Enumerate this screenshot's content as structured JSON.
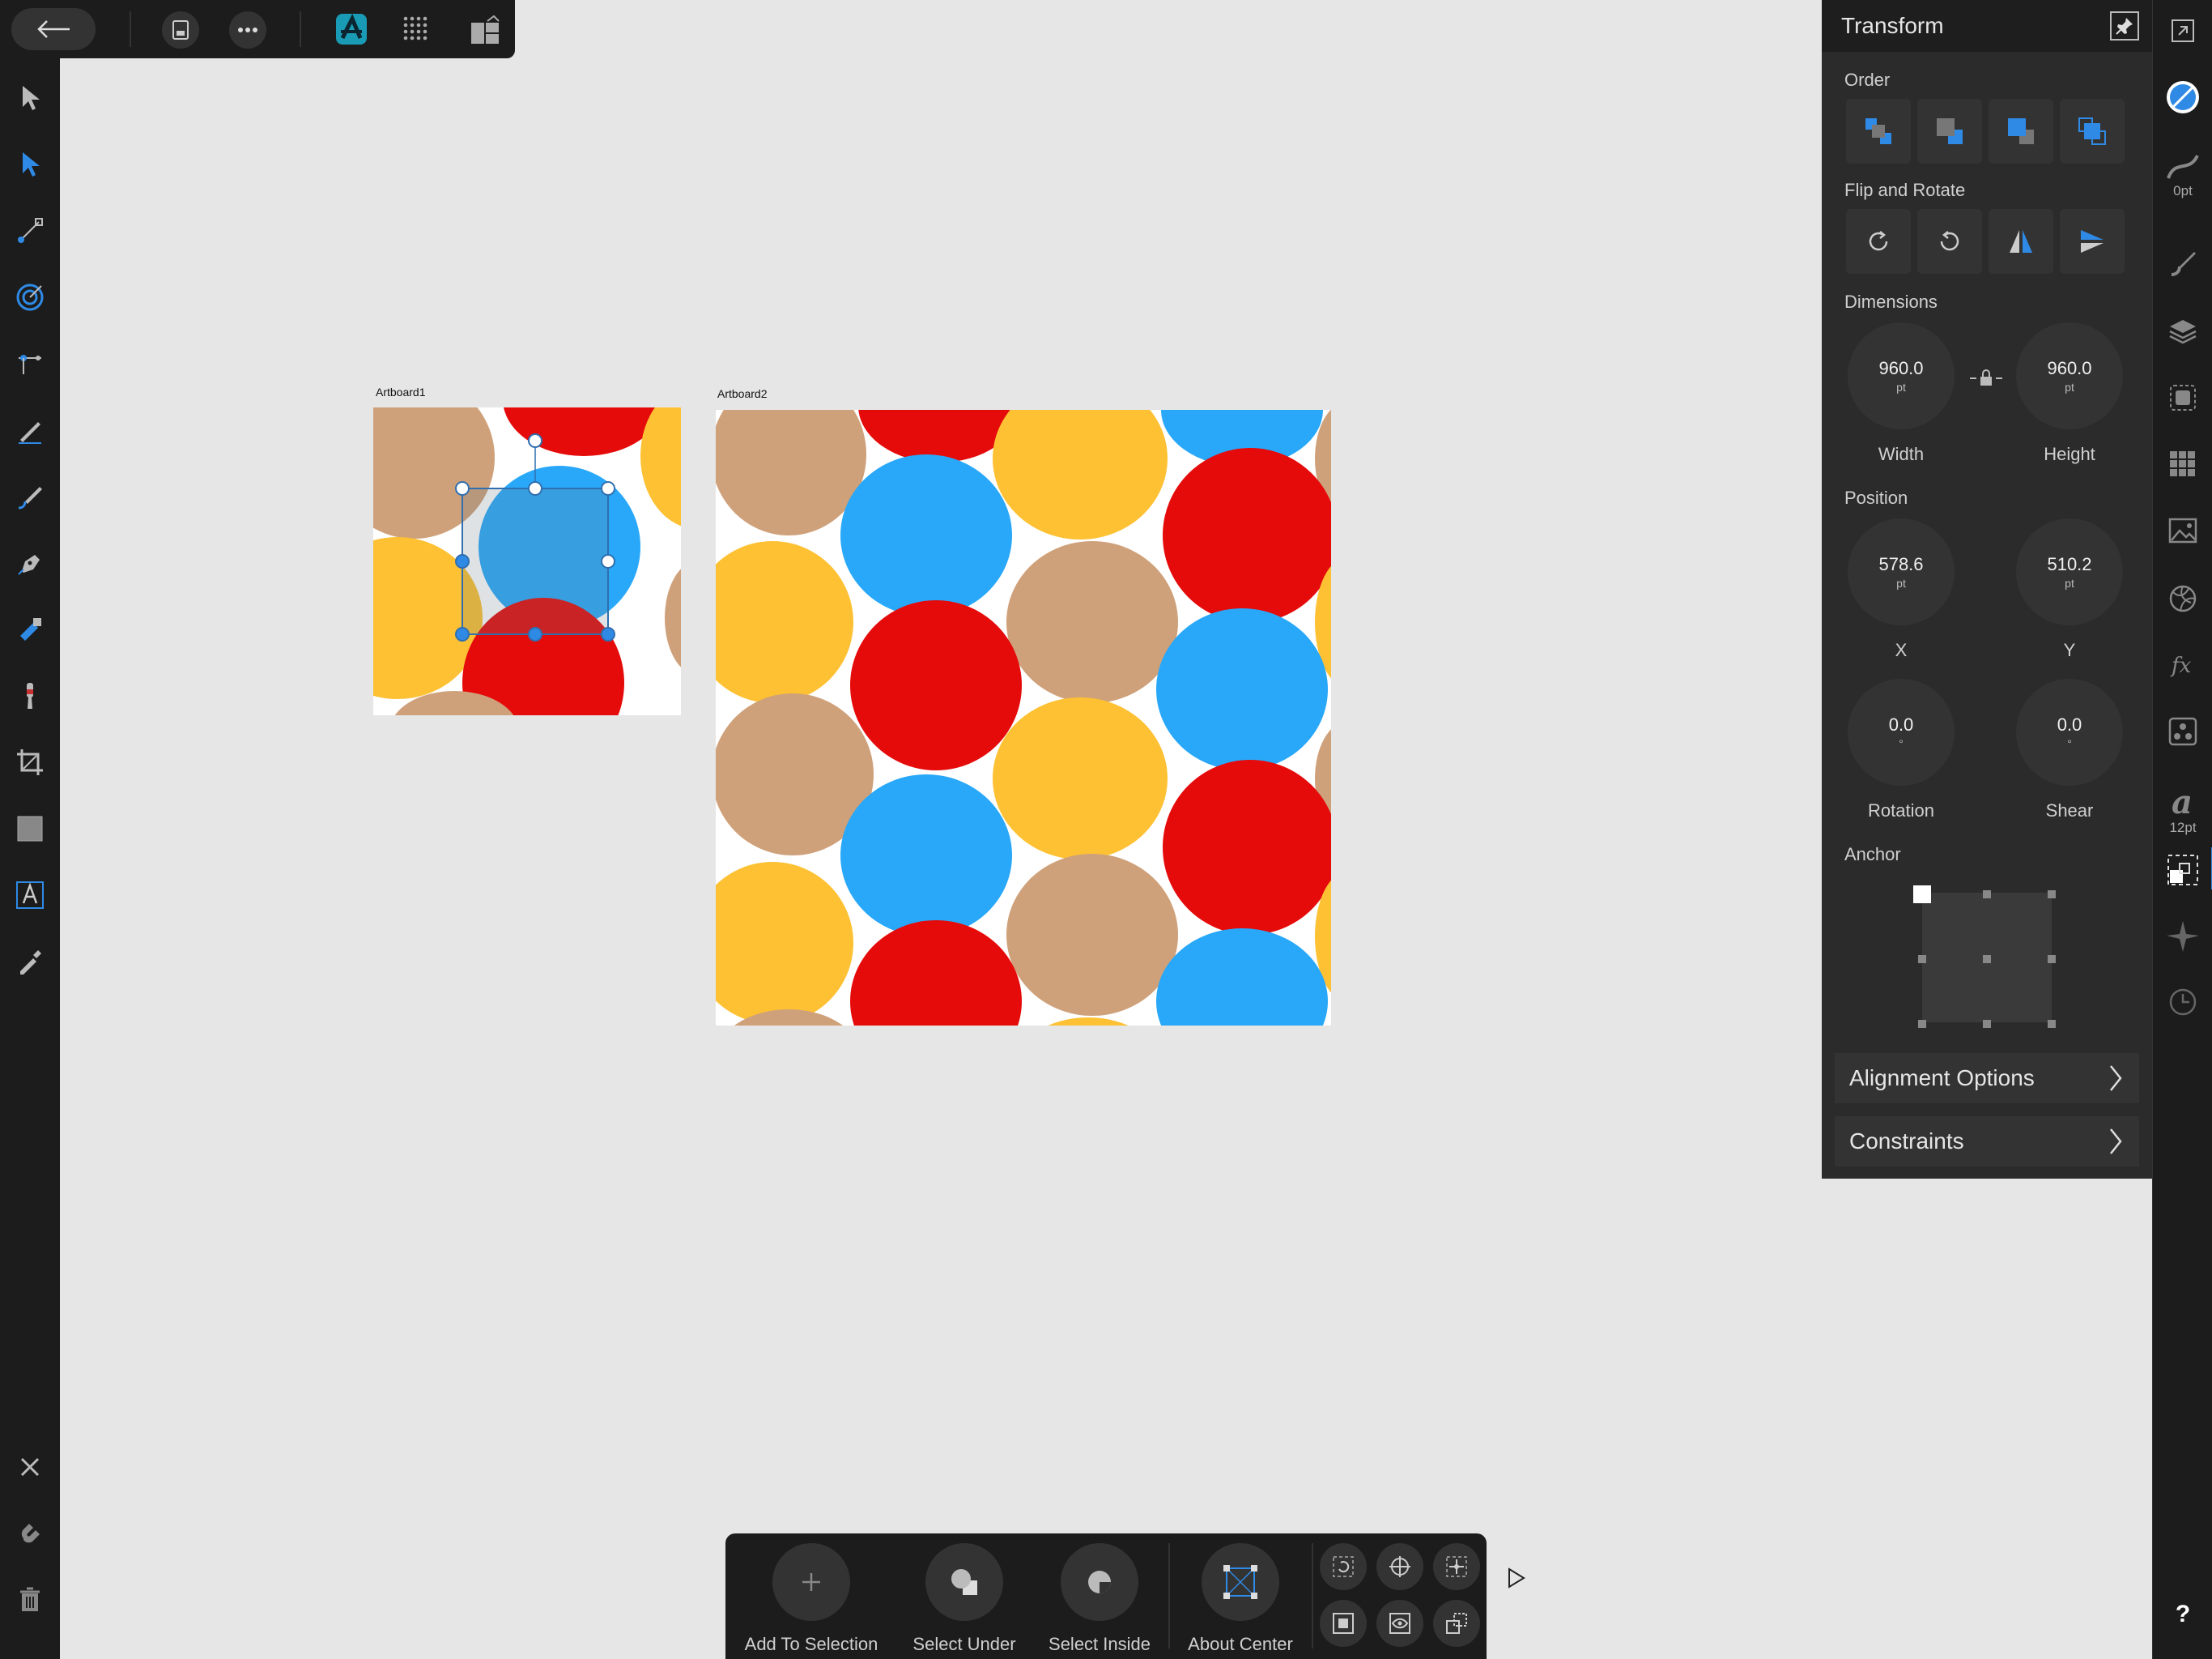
{
  "panel": {
    "title": "Transform",
    "sections": {
      "order": "Order",
      "flip_rotate": "Flip and Rotate",
      "dimensions": "Dimensions",
      "position": "Position",
      "anchor": "Anchor"
    },
    "dimensions": {
      "width": {
        "value": "960.0",
        "unit": "pt",
        "label": "Width"
      },
      "height": {
        "value": "960.0",
        "unit": "pt",
        "label": "Height"
      }
    },
    "position": {
      "x": {
        "value": "578.6",
        "unit": "pt",
        "label": "X"
      },
      "y": {
        "value": "510.2",
        "unit": "pt",
        "label": "Y"
      }
    },
    "rotation": {
      "value": "0.0",
      "unit": "°",
      "label": "Rotation"
    },
    "shear": {
      "value": "0.0",
      "unit": "°",
      "label": "Shear"
    },
    "alignment_options": "Alignment Options",
    "constraints": "Constraints"
  },
  "studio": {
    "stroke_width": "0pt",
    "font_size": "12pt",
    "help": "?"
  },
  "canvas": {
    "artboard1_label": "Artboard1",
    "artboard2_label": "Artboard2"
  },
  "context_bar": {
    "add_to_selection": "Add To Selection",
    "select_under": "Select Under",
    "select_inside": "Select Inside",
    "about_center": "About Center"
  },
  "colors": {
    "tan": "#cfa17a",
    "red": "#e50b0b",
    "blue": "#29a8f9",
    "yellow": "#fdc133",
    "accent": "#2f8ae6"
  }
}
